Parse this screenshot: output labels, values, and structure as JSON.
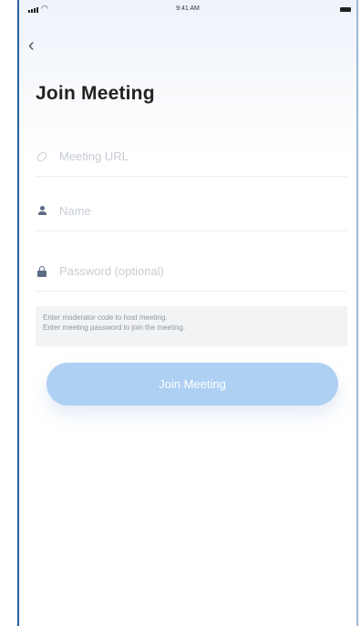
{
  "status_bar": {
    "time": "9:41 AM",
    "signal_icon": "cellular-signal-icon",
    "wifi_icon": "wifi-icon",
    "battery_icon": "battery-icon"
  },
  "nav": {
    "back_glyph": "‹",
    "back_icon": "chevron-left-icon"
  },
  "page": {
    "title": "Join Meeting"
  },
  "form": {
    "meeting_url": {
      "placeholder": "Meeting URL",
      "value": "",
      "icon": "link-icon"
    },
    "name": {
      "placeholder": "Name",
      "value": "",
      "icon": "user-icon"
    },
    "password": {
      "placeholder": "Password (optional)",
      "value": "",
      "icon": "lock-icon"
    }
  },
  "hint": {
    "line1": "Enter moderator code to host meeting.",
    "line2": "Enter meeting password to join the meeting."
  },
  "join_button": {
    "label": "Join Meeting",
    "color": "#aed0f3"
  },
  "colors": {
    "frame_border": "#2a5f9e",
    "title": "#222222",
    "placeholder": "#c7ccd4",
    "hint_background": "#f2f3f5"
  }
}
